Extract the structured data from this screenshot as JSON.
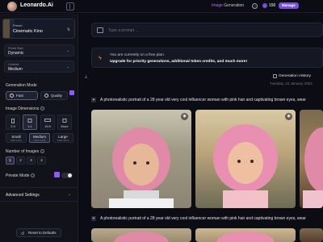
{
  "app": {
    "brand": "Leonardo.Ai",
    "title_accent": "Image",
    "title_rest": " Generation",
    "tokens": "150",
    "manage_label": "Manage"
  },
  "sidebar": {
    "preset": {
      "label": "Preset",
      "value": "Cinematic Kino"
    },
    "preset_style": {
      "label": "Preset Style",
      "value": "Dynamic"
    },
    "contrast": {
      "label": "Contrast",
      "value": "Medium"
    },
    "generation_mode": {
      "title": "Generation Mode",
      "options": [
        "Fast",
        "Quality"
      ]
    },
    "image_dimensions": {
      "title": "Image Dimensions",
      "ratios": [
        "2:3",
        "1:1",
        "16:9",
        "More"
      ],
      "sizes": [
        {
          "name": "Small",
          "dims": "848×1264"
        },
        {
          "name": "Medium",
          "dims": "1024×1536"
        },
        {
          "name": "Large",
          "dims": "1248×1872"
        }
      ]
    },
    "number_of_images": {
      "title": "Number of Images",
      "options": [
        "1",
        "2",
        "3",
        "4"
      ]
    },
    "private_mode": {
      "title": "Private Mode"
    },
    "advanced_settings": "Advanced Settings",
    "reset_label": "Reset to Defaults"
  },
  "main": {
    "prompt_placeholder": "Type a prompt ...",
    "banner": {
      "line1": "You are currently on a free plan.",
      "line2": "Upgrade for priority generations, additional token credits, and much more!"
    },
    "history_label": "Generation History",
    "date": "Tuesday, 23 January 2024",
    "generations": [
      {
        "prompt": "A photorealistic portrait of a 28 year old very cool influencer woman with pink hair and captivating brown eyes, wear"
      },
      {
        "prompt": "A photorealistic portrait of a 28 year old very cool influencer woman with pink hair and captivating brown eyes, wear"
      }
    ]
  },
  "colors": {
    "accent": "#8b5cf6",
    "background": "#0c0d14",
    "warning": "#f59e0b"
  }
}
